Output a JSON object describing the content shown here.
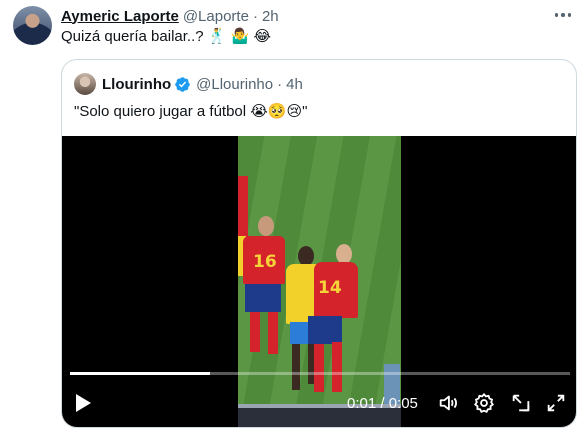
{
  "tweet": {
    "author_name": "Aymeric Laporte",
    "handle": "@Laporte",
    "separator": "·",
    "time": "2h",
    "text": "Quizá quería bailar..? 🕺 🤷‍♂️ 😂"
  },
  "quote": {
    "author_name": "Llourinho",
    "verified": true,
    "handle": "@Llourinho",
    "separator": "·",
    "time": "4h",
    "text": "\"Solo quiero jugar a fútbol 😭🥺😢\""
  },
  "video": {
    "timecode": "0:01 / 0:05",
    "progress": 0.28,
    "player_numbers": [
      "16",
      "14"
    ]
  },
  "icons": {
    "more": "more-dots-icon",
    "verified": "verified-badge-icon",
    "play": "play-icon",
    "volume": "volume-icon",
    "settings": "gear-icon",
    "popout": "popout-icon",
    "fullscreen": "fullscreen-icon"
  },
  "colors": {
    "text_primary": "#0f1419",
    "text_secondary": "#536471",
    "border": "#cfd9de",
    "verified_blue": "#1d9bf0"
  }
}
